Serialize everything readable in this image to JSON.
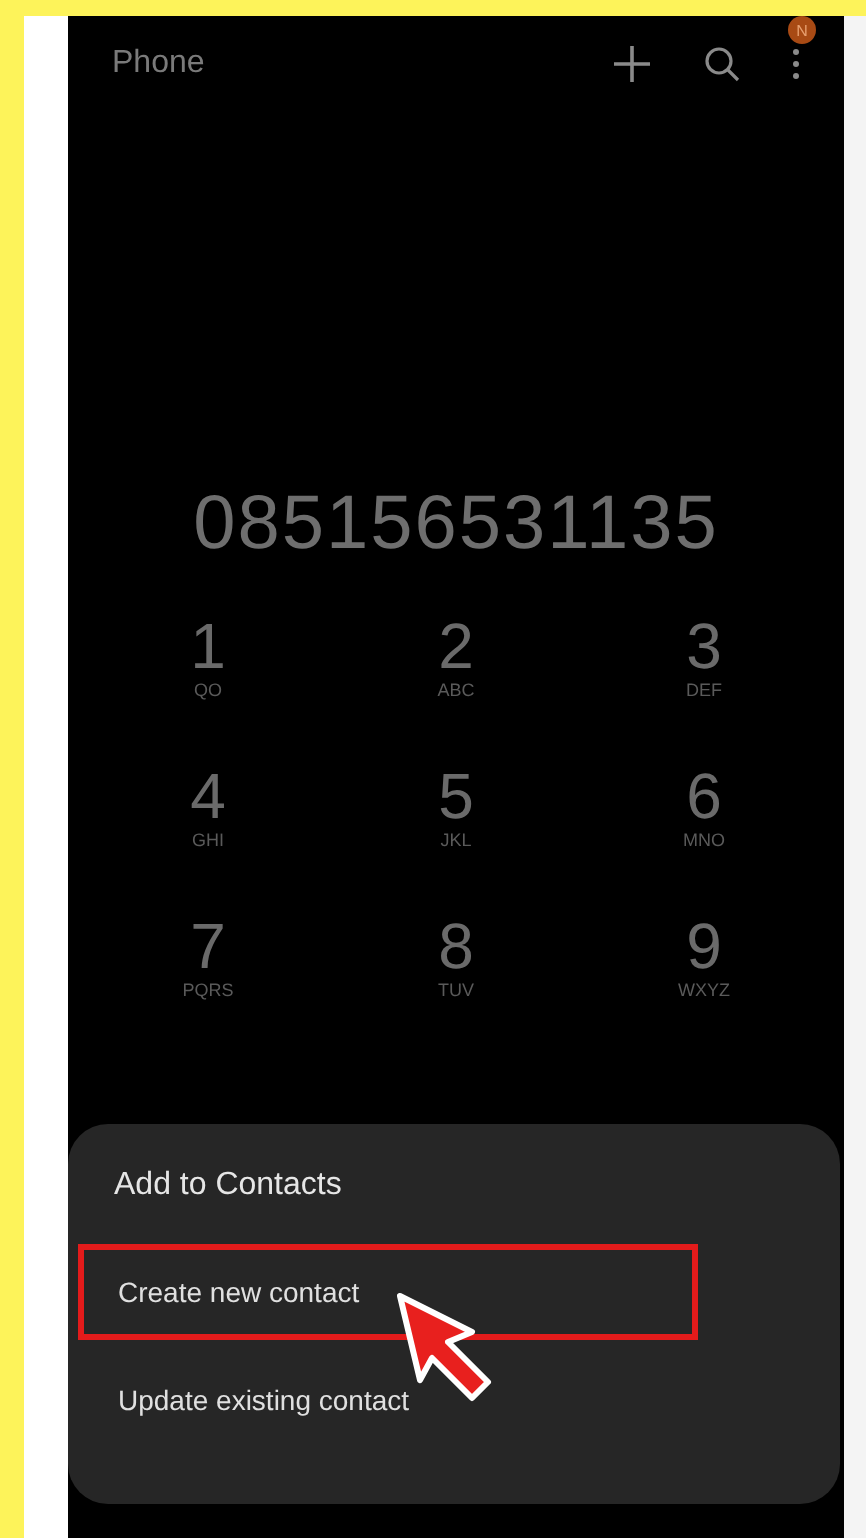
{
  "app_bar": {
    "title": "Phone",
    "badge": "N"
  },
  "number": "085156531135",
  "keypad": [
    {
      "digit": "1",
      "letters": "QO"
    },
    {
      "digit": "2",
      "letters": "ABC"
    },
    {
      "digit": "3",
      "letters": "DEF"
    },
    {
      "digit": "4",
      "letters": "GHI"
    },
    {
      "digit": "5",
      "letters": "JKL"
    },
    {
      "digit": "6",
      "letters": "MNO"
    },
    {
      "digit": "7",
      "letters": "PQRS"
    },
    {
      "digit": "8",
      "letters": "TUV"
    },
    {
      "digit": "9",
      "letters": "WXYZ"
    }
  ],
  "sheet": {
    "title": "Add to Contacts",
    "options": [
      {
        "label": "Create new contact",
        "highlighted": true
      },
      {
        "label": "Update existing contact",
        "highlighted": false
      }
    ]
  }
}
